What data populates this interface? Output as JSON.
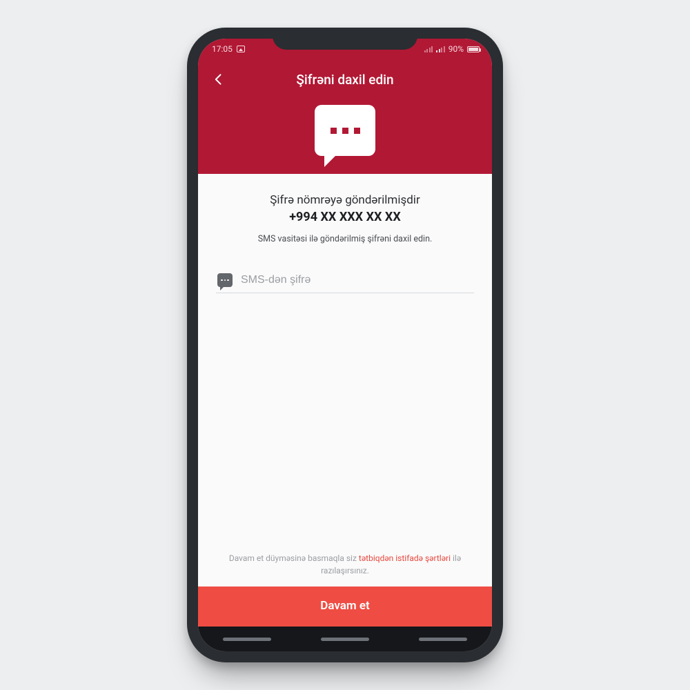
{
  "status": {
    "time": "17:05",
    "battery_pct": "90%"
  },
  "header": {
    "title": "Şifrəni daxil edin"
  },
  "main": {
    "sent_label": "Şifrə nömrəyə göndərilmişdir",
    "phone_number": "+994 XX XXX XX XX",
    "hint": "SMS vasitəsi ilə göndərilmiş şifrəni daxil edin.",
    "code_placeholder": "SMS-dən şifrə"
  },
  "footer": {
    "terms_prefix": "Davam et düyməsinə basmaqla siz ",
    "terms_link": "tətbiqdən istifadə şərtləri",
    "terms_suffix": " ilə razılaşırsınız.",
    "cta_label": "Davam et"
  }
}
